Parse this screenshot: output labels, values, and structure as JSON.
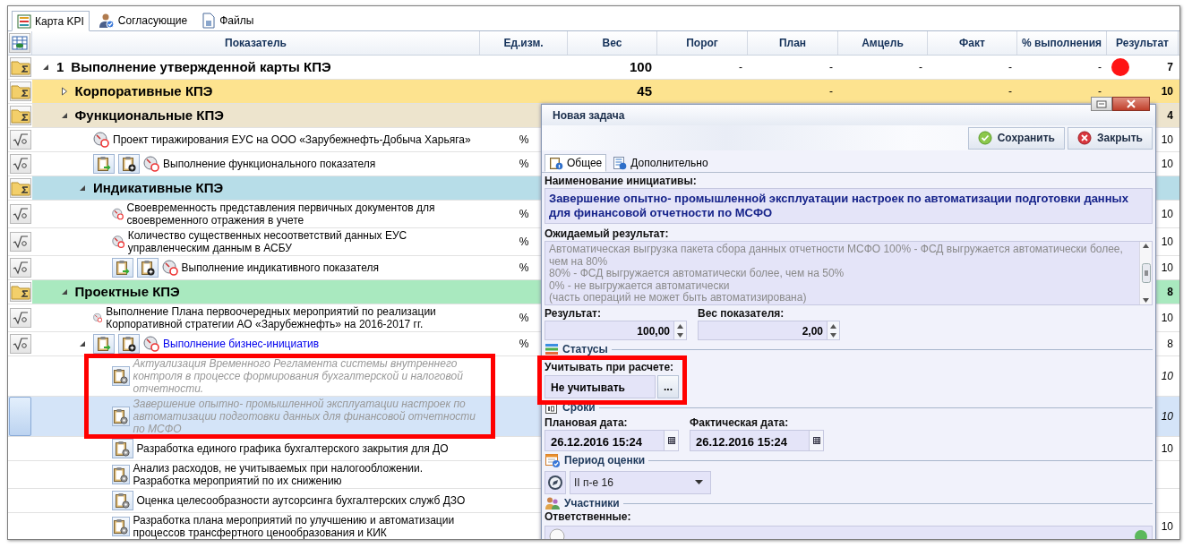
{
  "tabs": [
    {
      "label": "Карта KPI",
      "kind": "map",
      "selected": true
    },
    {
      "label": "Согласующие",
      "kind": "people",
      "selected": false
    },
    {
      "label": "Файлы",
      "kind": "files",
      "selected": false
    }
  ],
  "table": {
    "columns": [
      "Показатель",
      "Ед.изм.",
      "Вес",
      "Порог",
      "План",
      "Амцель",
      "Факт",
      "% выполнения",
      "Результат"
    ],
    "rows": [
      {
        "kind": "group",
        "number": "1",
        "label": "Выполнение утвержденной карты КПЭ",
        "expanded": true,
        "selected": false,
        "weight": "100",
        "threshold": "-",
        "plan": "-",
        "target": "-",
        "fact": "-",
        "percent": "-",
        "status": {
          "color": "#ff1414"
        },
        "result": "7",
        "children": [
          {
            "kind": "group",
            "label": "Корпоративные КПЭ",
            "color": "#fde38f",
            "expanded": false,
            "selected": false,
            "weight": "45",
            "plan": "-",
            "fact": "-",
            "percent": "-",
            "result": "10"
          },
          {
            "kind": "group",
            "label": "Функциональные КПЭ",
            "color": "#ede4cd",
            "expanded": true,
            "selected": false,
            "result": "4",
            "children": [
              {
                "kind": "indicator",
                "label": "Проект тиражирования ЕУС на ООО «Зарубежнефть-Добыча Харьяга»",
                "selected": false,
                "unit": "%",
                "result": "10"
              },
              {
                "kind": "indicator",
                "label": "Выполнение функционального показателя",
                "add_buttons": true,
                "selected": false,
                "unit": "%",
                "result": "10"
              },
              {
                "kind": "group",
                "label": "Индикативные КПЭ",
                "color": "#b7dde8",
                "expanded": true,
                "selected": false,
                "children": [
                  {
                    "kind": "indicator",
                    "label": "Своевременность представления первичных документов для своевременного отражения в учете",
                    "selected": false,
                    "unit": "%",
                    "result": "10"
                  },
                  {
                    "kind": "indicator",
                    "label": "Количество существенных несоответствий данных ЕУС управленческим данным в АСБУ",
                    "selected": false,
                    "unit": "%",
                    "result": "10"
                  },
                  {
                    "kind": "indicator",
                    "label": "Выполнение индикативного показателя",
                    "add_buttons": true,
                    "selected": false,
                    "unit": "%",
                    "result": "10"
                  }
                ]
              }
            ]
          },
          {
            "kind": "group",
            "label": "Проектные КПЭ",
            "color": "#a9e9bf",
            "expanded": true,
            "selected": false,
            "result": "8",
            "children": [
              {
                "kind": "indicator",
                "label": "Выполнение Плана первоочередных мероприятий по реализации Корпоративной стратегии АО «Зарубежнефть» на 2016-2017 гг.",
                "selected": false,
                "unit": "%",
                "result": "10"
              },
              {
                "kind": "indicator",
                "label": "Выполнение бизнес-инициатив",
                "link": true,
                "add_buttons": true,
                "expanded": true,
                "selected": false,
                "unit": "%",
                "result": "8",
                "children": [
                  {
                    "kind": "task",
                    "label": "Актуализация Временного Регламента системы внутреннего контроля в процессе формирования бухгалтерской и налоговой отчетности.",
                    "excluded": true,
                    "selected": false,
                    "result": "10"
                  },
                  {
                    "kind": "task",
                    "label": "Завершение опытно- промышленной эксплуатации настроек по автоматизации подготовки данных для финансовой отчетности по МСФО",
                    "excluded": true,
                    "selected": true,
                    "result": "10"
                  },
                  {
                    "kind": "task",
                    "label": "Разработка единого графика бухгалтерского закрытия для ДО",
                    "excluded": false,
                    "selected": false,
                    "result": "10"
                  },
                  {
                    "kind": "task",
                    "label": "Анализ расходов, не учитываемых при налогообложении. Разработка мероприятий по их снижению",
                    "excluded": false,
                    "selected": false
                  },
                  {
                    "kind": "task",
                    "label": "Оценка целесообразности аутсорсинга бухгалтерских служб ДЗО",
                    "excluded": false,
                    "selected": false
                  },
                  {
                    "kind": "task",
                    "label": "Разработка плана мероприятий по улучшению и автоматизации процессов трансфертного ценообразования и КИК",
                    "excluded": false,
                    "selected": false,
                    "result": "10"
                  }
                ]
              }
            ]
          }
        ]
      }
    ]
  },
  "dialog": {
    "title": "Новая задача",
    "buttons": [
      {
        "label": "Сохранить",
        "kind": "save"
      },
      {
        "label": "Закрыть",
        "kind": "close"
      }
    ],
    "tabs": [
      {
        "label": "Общее",
        "selected": true
      },
      {
        "label": "Дополнительно",
        "selected": false
      }
    ],
    "name": {
      "label": "Наименование инициативы:",
      "value": "Завершение опытно- промышленной эксплуатации настроек по автоматизации подготовки данных для финансовой отчетности по МСФО"
    },
    "expected": {
      "label": "Ожидаемый результат:",
      "lines": [
        "Автоматическая выгрузка пакета сбора данных отчетности МСФО 100% - ФСД выгружается автоматически более, чем на 80%",
        "80% - ФСД выгружается автоматически более, чем на 50%",
        "0% - не выгружается автоматически",
        "(часть операций не может быть автоматизирована)"
      ]
    },
    "result": {
      "label": "Результат:",
      "value": "100,00"
    },
    "weight": {
      "label": "Вес показателя:",
      "value": "2,00"
    },
    "statuses": {
      "title": "Статусы",
      "label": "Учитывать при расчете:",
      "value": "Не учитывать",
      "button": "..."
    },
    "dates": {
      "title": "Сроки",
      "planned": {
        "label": "Плановая дата:",
        "value": "26.12.2016 15:24"
      },
      "actual": {
        "label": "Фактическая дата:",
        "value": "26.12.2016 15:24"
      }
    },
    "period": {
      "title": "Период оценки",
      "value": "II п-е 16"
    },
    "participants": {
      "title": "Участники",
      "label": "Ответственные:"
    }
  }
}
